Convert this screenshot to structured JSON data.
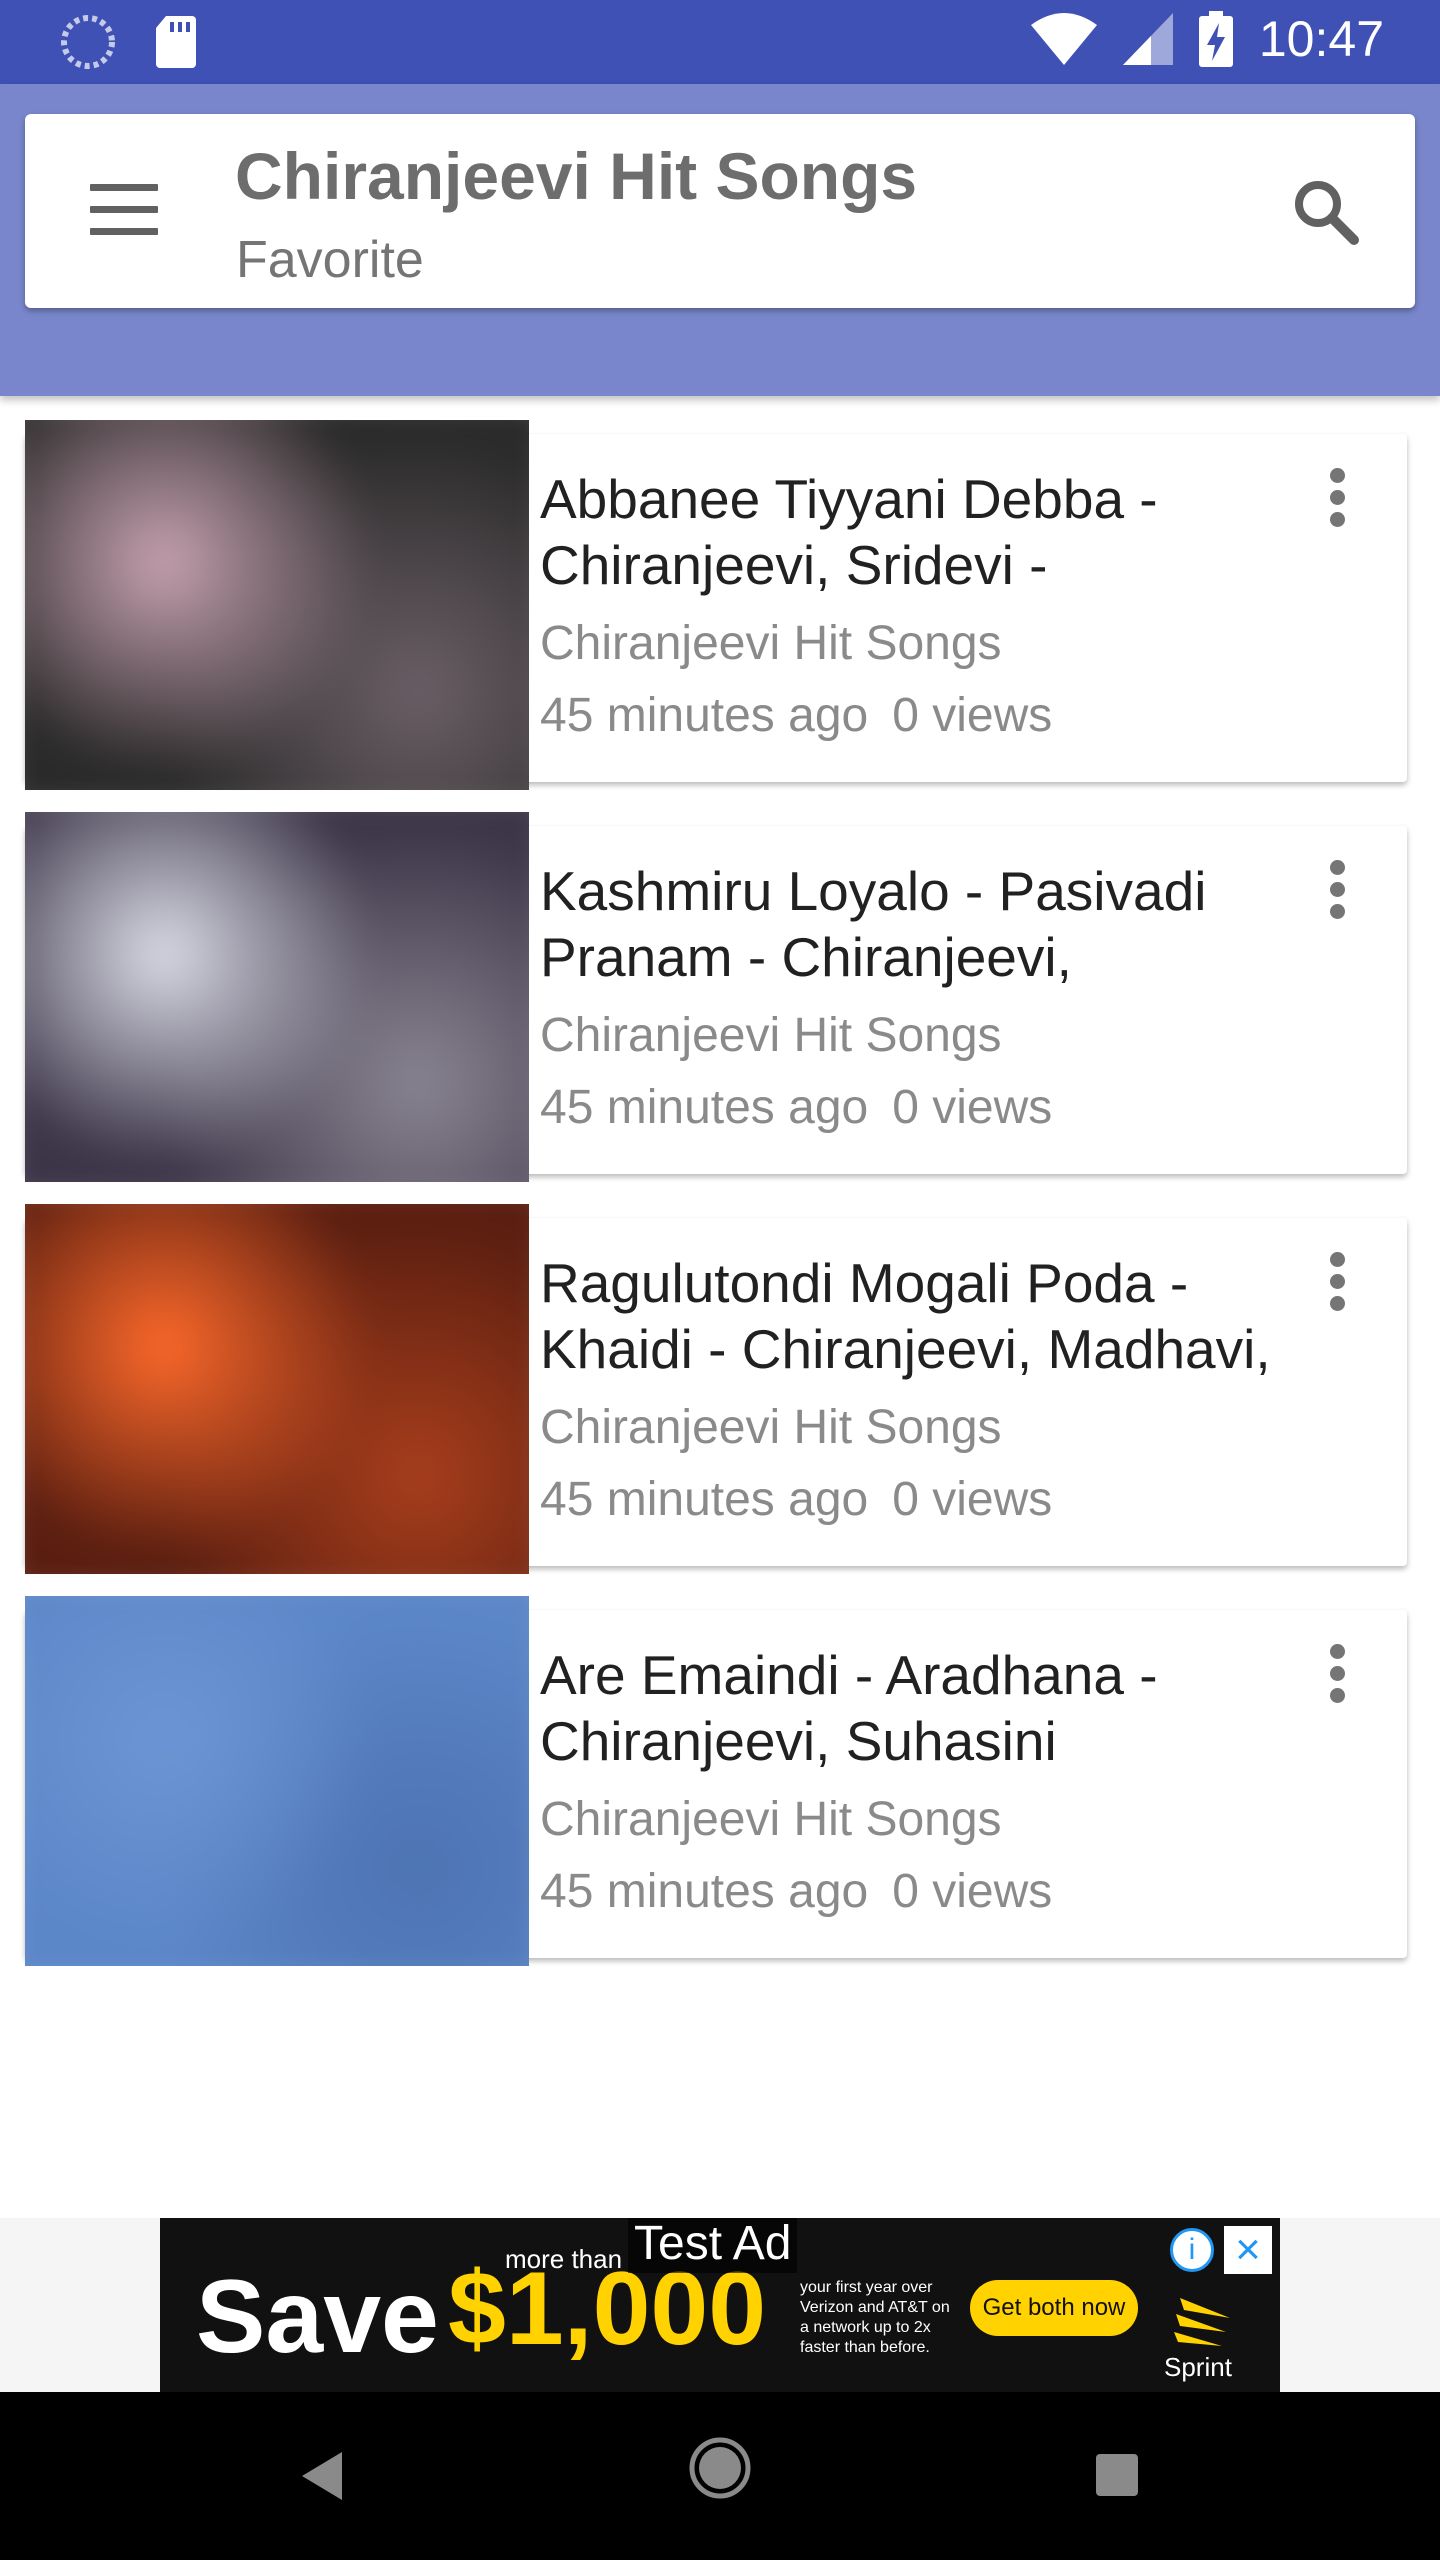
{
  "status_bar": {
    "time": "10:47",
    "icons": [
      "spinner-icon",
      "sd-card-icon",
      "wifi-icon",
      "signal-icon",
      "battery-charging-icon"
    ]
  },
  "app_bar": {
    "title": "Chiranjeevi Hit Songs",
    "subtitle": "Favorite",
    "menu_icon": "hamburger-menu-icon",
    "search_icon": "search-icon",
    "color_primary": "#3f51b5",
    "color_light": "#7986cb"
  },
  "videos": [
    {
      "title": "Abbanee Tiyyani Debba - Chiranjeevi, Sridevi -",
      "channel": "Chiranjeevi Hit Songs",
      "time_ago": "45 minutes ago",
      "views": "0 views",
      "thumb_colors": [
        "#2a2a2a",
        "#c9a3b3",
        "#6b5f66"
      ]
    },
    {
      "title": "Kashmiru Loyalo - Pasivadi Pranam - Chiranjeevi,",
      "channel": "Chiranjeevi Hit Songs",
      "time_ago": "45 minutes ago",
      "views": "0 views",
      "thumb_colors": [
        "#3c3548",
        "#dcdde8",
        "#8a8592"
      ]
    },
    {
      "title": "Ragulutondi Mogali Poda - Khaidi - Chiranjeevi, Madhavi,",
      "channel": "Chiranjeevi Hit Songs",
      "time_ago": "45 minutes ago",
      "views": "0 views",
      "thumb_colors": [
        "#5a1e10",
        "#ff6a2b",
        "#a83e1c"
      ]
    },
    {
      "title": "Are Emaindi - Aradhana - Chiranjeevi, Suhasini",
      "channel": "Chiranjeevi Hit Songs",
      "time_ago": "45 minutes ago",
      "views": "0 views",
      "thumb_colors": [
        "#5b86c8",
        "#6c95d4",
        "#4d73b2"
      ]
    }
  ],
  "ad": {
    "label": "Test Ad",
    "save": "Save",
    "more_than": "more than",
    "amount": "$1,000",
    "fine_print": "your first year over Verizon and AT&T on a network up to 2x faster than before.",
    "button": "Get both now",
    "brand": "Sprint",
    "info_icon": "info-icon",
    "close_icon": "close-icon"
  },
  "nav_bar": {
    "icons": [
      "back-icon",
      "home-icon",
      "recents-icon"
    ]
  }
}
